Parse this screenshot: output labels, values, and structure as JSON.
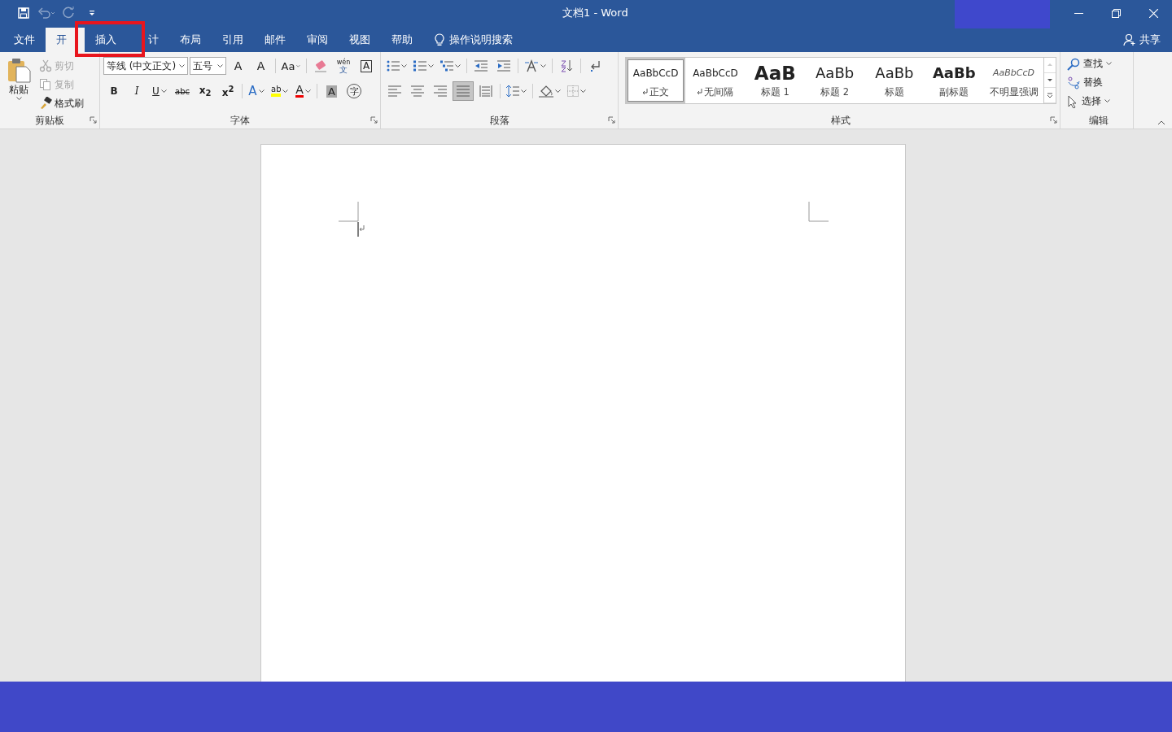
{
  "window": {
    "title": "文档1  -  Word"
  },
  "quick_access": [
    {
      "kind": "save",
      "disabled": false
    },
    {
      "kind": "undo",
      "disabled": true
    },
    {
      "kind": "redo",
      "disabled": true
    },
    {
      "kind": "customize",
      "disabled": false
    }
  ],
  "tabs": [
    {
      "label": "文件",
      "selected": false
    },
    {
      "label": "开",
      "selected": true
    },
    {
      "label": "插入",
      "selected": false
    },
    {
      "label": "计",
      "selected": false
    },
    {
      "label": "布局",
      "selected": false
    },
    {
      "label": "引用",
      "selected": false
    },
    {
      "label": "邮件",
      "selected": false
    },
    {
      "label": "审阅",
      "selected": false
    },
    {
      "label": "视图",
      "selected": false
    },
    {
      "label": "帮助",
      "selected": false
    }
  ],
  "tell_me": {
    "placeholder": "操作说明搜索"
  },
  "share": {
    "label": "共享"
  },
  "ribbon": {
    "groups": [
      {
        "kind": "clipboard",
        "name": "剪贴板",
        "paste": "粘贴",
        "items": [
          {
            "kind": "cut",
            "label": "剪切",
            "disabled": true
          },
          {
            "kind": "copy",
            "label": "复制",
            "disabled": true
          },
          {
            "kind": "painter",
            "label": "格式刷",
            "disabled": false
          }
        ]
      },
      {
        "kind": "font",
        "name": "字体",
        "font": "等线 (中文正文)",
        "size": "五号",
        "row1": [
          {
            "kind": "grow",
            "text": "A"
          },
          {
            "kind": "shrink",
            "text": "A"
          },
          {
            "kind": "case",
            "text": "Aa",
            "dropdown": true
          },
          {
            "kind": "clear"
          },
          {
            "kind": "phonetic",
            "text": "wén",
            "sub": "文"
          },
          {
            "kind": "border",
            "text": "A"
          }
        ],
        "row2": [
          {
            "kind": "bold",
            "text": "B"
          },
          {
            "kind": "italic",
            "text": "I"
          },
          {
            "kind": "underline",
            "text": "U",
            "dropdown": true
          },
          {
            "kind": "strike",
            "text": "abc"
          },
          {
            "kind": "sub",
            "text": "x$_{2}$"
          },
          {
            "kind": "sup",
            "text": "x$^{2}$"
          },
          {
            "kind": "effects",
            "text": "A",
            "dropdown": true
          },
          {
            "kind": "highlight",
            "text": "ab",
            "dropdown": true
          },
          {
            "kind": "color",
            "text": "A",
            "dropdown": true
          },
          {
            "kind": "shading",
            "text": "A"
          },
          {
            "kind": "enclosed",
            "text": "字"
          }
        ]
      },
      {
        "kind": "paragraph",
        "name": "段落",
        "row1": [
          {
            "kind": "bullets",
            "dropdown": true
          },
          {
            "kind": "numbering",
            "dropdown": true
          },
          {
            "kind": "multilevel",
            "dropdown": true
          },
          {
            "kind": "outdent"
          },
          {
            "kind": "indent"
          },
          {
            "kind": "asian",
            "dropdown": true
          },
          {
            "kind": "sort"
          },
          {
            "kind": "marks"
          }
        ],
        "row2": [
          {
            "kind": "left",
            "selected": false
          },
          {
            "kind": "center",
            "selected": false
          },
          {
            "kind": "right",
            "selected": false
          },
          {
            "kind": "justify",
            "selected": true
          },
          {
            "kind": "distribute",
            "selected": false
          },
          {
            "kind": "spacing",
            "dropdown": true
          },
          {
            "kind": "fill",
            "dropdown": true
          },
          {
            "kind": "borders",
            "dropdown": true
          }
        ]
      },
      {
        "kind": "styles",
        "name": "样式",
        "styles": [
          {
            "preview": "AaBbCcD",
            "label": "正文",
            "kind": "normal",
            "mark": true,
            "selected": true
          },
          {
            "preview": "AaBbCcD",
            "label": "无间隔",
            "kind": "normal",
            "mark": true,
            "selected": false
          },
          {
            "preview": "AaB",
            "label": "标题 1",
            "kind": "heading",
            "mark": false,
            "selected": false
          },
          {
            "preview": "AaBb",
            "label": "标题 2",
            "kind": "subheading",
            "mark": false,
            "selected": false
          },
          {
            "preview": "AaBb",
            "label": "标题",
            "kind": "title",
            "mark": false,
            "selected": false
          },
          {
            "preview": "AaBb",
            "label": "副标题",
            "kind": "subtitle",
            "mark": false,
            "selected": false
          },
          {
            "preview": "AaBbCcD",
            "label": "不明显强调",
            "kind": "emphasis",
            "mark": false,
            "selected": false
          }
        ]
      },
      {
        "kind": "editing",
        "name": "编辑",
        "items": [
          {
            "kind": "find",
            "label": "查找",
            "dropdown": true
          },
          {
            "kind": "replace",
            "label": "替换"
          },
          {
            "kind": "select",
            "label": "选择",
            "dropdown": true
          }
        ]
      }
    ]
  },
  "annotation": {
    "kind": "highlight-box",
    "color": "#e8151d"
  }
}
